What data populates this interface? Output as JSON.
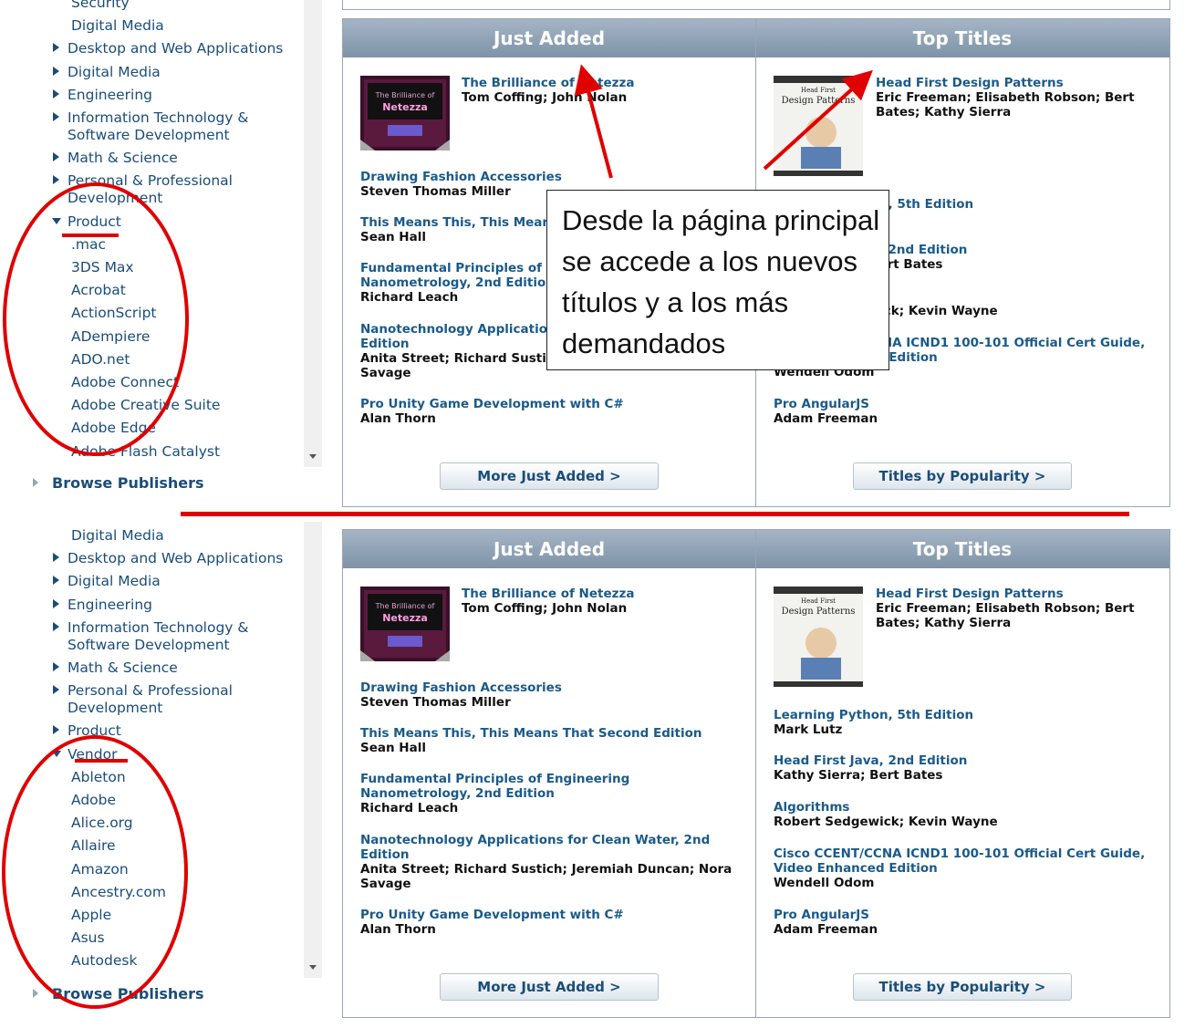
{
  "top": {
    "sidebar": {
      "items": [
        {
          "label": "Security",
          "type": "sub"
        },
        {
          "label": "Digital Media",
          "type": "sub"
        },
        {
          "label": "Desktop and Web Applications",
          "type": "cat"
        },
        {
          "label": "Digital Media",
          "type": "cat"
        },
        {
          "label": "Engineering",
          "type": "cat"
        },
        {
          "label": "Information Technology &",
          "type": "cat"
        },
        {
          "label": "Software Development",
          "type": "cont"
        },
        {
          "label": "Math & Science",
          "type": "cat"
        },
        {
          "label": "Personal & Professional",
          "type": "cat"
        },
        {
          "label": "Development",
          "type": "cont"
        },
        {
          "label": "Product",
          "type": "open"
        },
        {
          "label": ".mac",
          "type": "sub"
        },
        {
          "label": "3DS Max",
          "type": "sub"
        },
        {
          "label": "Acrobat",
          "type": "sub"
        },
        {
          "label": "ActionScript",
          "type": "sub"
        },
        {
          "label": "ADempiere",
          "type": "sub"
        },
        {
          "label": "ADO.net",
          "type": "sub"
        },
        {
          "label": "Adobe Connect",
          "type": "sub"
        },
        {
          "label": "Adobe Creative Suite",
          "type": "sub"
        },
        {
          "label": "Adobe Edge",
          "type": "sub"
        },
        {
          "label": "Adobe Flash Catalyst",
          "type": "sub"
        }
      ],
      "browse_publishers": "Browse Publishers"
    }
  },
  "bottom": {
    "sidebar": {
      "items": [
        {
          "label": "Digital Media",
          "type": "sub"
        },
        {
          "label": "Desktop and Web Applications",
          "type": "cat"
        },
        {
          "label": "Digital Media",
          "type": "cat"
        },
        {
          "label": "Engineering",
          "type": "cat"
        },
        {
          "label": "Information Technology &",
          "type": "cat"
        },
        {
          "label": "Software Development",
          "type": "cont"
        },
        {
          "label": "Math & Science",
          "type": "cat"
        },
        {
          "label": "Personal & Professional",
          "type": "cat"
        },
        {
          "label": "Development",
          "type": "cont"
        },
        {
          "label": "Product",
          "type": "cat"
        },
        {
          "label": "Vendor",
          "type": "open"
        },
        {
          "label": "Ableton",
          "type": "sub"
        },
        {
          "label": "Adobe",
          "type": "sub"
        },
        {
          "label": "Alice.org",
          "type": "sub"
        },
        {
          "label": "Allaire",
          "type": "sub"
        },
        {
          "label": "Amazon",
          "type": "sub"
        },
        {
          "label": "Ancestry.com",
          "type": "sub"
        },
        {
          "label": "Apple",
          "type": "sub"
        },
        {
          "label": "Asus",
          "type": "sub"
        },
        {
          "label": "Autodesk",
          "type": "sub"
        }
      ],
      "browse_publishers": "Browse Publishers"
    }
  },
  "panel": {
    "just_added_header": "Just Added",
    "top_titles_header": "Top Titles",
    "just_added": [
      {
        "title": "The Brilliance of Netezza",
        "author": "Tom Coffing; John Nolan"
      },
      {
        "title": "Drawing Fashion Accessories",
        "author": "Steven Thomas Miller"
      },
      {
        "title": "This Means This, This Means That Second Edition",
        "author": "Sean Hall"
      },
      {
        "title": "Fundamental Principles of Engineering Nanometrology, 2nd Edition",
        "author": "Richard Leach"
      },
      {
        "title": "Nanotechnology Applications for Clean Water, 2nd Edition",
        "author": "Anita Street; Richard Sustich; Jeremiah Duncan; Nora Savage"
      },
      {
        "title": "Pro Unity Game Development with C#",
        "author": "Alan Thorn"
      }
    ],
    "top_titles": [
      {
        "title": "Head First Design Patterns",
        "author": "Eric Freeman; Elisabeth Robson; Bert Bates; Kathy Sierra"
      },
      {
        "title": "Learning Python, 5th Edition",
        "author": "Mark Lutz"
      },
      {
        "title": "Head First Java, 2nd Edition",
        "author": "Kathy Sierra; Bert Bates"
      },
      {
        "title": "Algorithms",
        "author": "Robert Sedgewick; Kevin Wayne"
      },
      {
        "title": "Cisco CCENT/CCNA ICND1 100-101 Official Cert Guide, Video Enhanced Edition",
        "author": "Wendell Odom"
      },
      {
        "title": "Pro AngularJS",
        "author": "Adam Freeman"
      }
    ],
    "more_just_added": "More Just Added >",
    "titles_by_popularity": "Titles by Popularity >",
    "cover_netezza_text": "The Brilliance of Netezza",
    "cover_headfirst_text": "Head First Design Patterns"
  },
  "annotation": {
    "callout_text": "Desde la página principal se accede a los nuevos títulos y a los más demandados"
  },
  "colors": {
    "link": "#1a5a8a",
    "header": "#8ea2b6",
    "annotation": "#e00000"
  }
}
